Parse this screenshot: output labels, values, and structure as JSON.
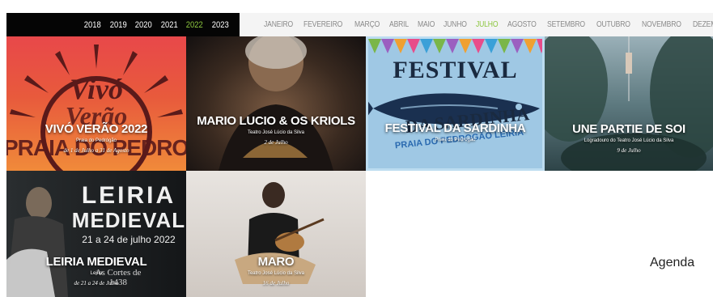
{
  "years": [
    "2018",
    "2019",
    "2020",
    "2021",
    "2022",
    "2023"
  ],
  "active_year": "2022",
  "months": [
    "JANEIRO",
    "FEVEREIRO",
    "MARÇO",
    "ABRIL",
    "MAIO",
    "JUNHO",
    "JULHO",
    "AGOSTO",
    "SETEMBRO",
    "OUTUBRO",
    "NOVEMBRO",
    "DEZEMBRO"
  ],
  "active_month": "JULHO",
  "colors": {
    "accent": "#8cc63f"
  },
  "events": [
    {
      "title": "VIVÓ VERÃO 2022",
      "venue": "Praia do Pedrógão",
      "date": "de 1 de Julho a 31 de Agosto",
      "poster": {
        "line1": "Vivó",
        "line2": "Verão",
        "line3": "PRAIA DO PEDROGÃO"
      }
    },
    {
      "title": "MARIO LUCIO & OS KRIOLS",
      "venue": "Teatro José Lúcio da Silva",
      "date": "2 de Julho"
    },
    {
      "title": "FESTIVAL DA SARDINHA",
      "venue": "Praia do Pedrógão",
      "date": "",
      "poster": {
        "line1": "FESTIVAL",
        "line2": "DA SARDINHA",
        "line3": "PRAIA DO PEDROGÃO LEIRIA"
      }
    },
    {
      "title": "UNE PARTIE DE SOI",
      "venue": "Logradouro do Teatro José Lúcio da Silva",
      "date": "9 de Julho"
    },
    {
      "title": "LEIRIA MEDIEVAL",
      "venue": "Leiria",
      "date": "de 21 a 24 de Julho",
      "poster": {
        "line1": "LEIRIA",
        "line2": "MEDIEVAL",
        "line3": "21 a 24 de julho 2022",
        "line4": "As Cortes de 1438"
      }
    },
    {
      "title": "MARO",
      "venue": "Teatro José Lúcio da Silva",
      "date": "16 de Julho"
    }
  ],
  "agenda_label": "Agenda"
}
